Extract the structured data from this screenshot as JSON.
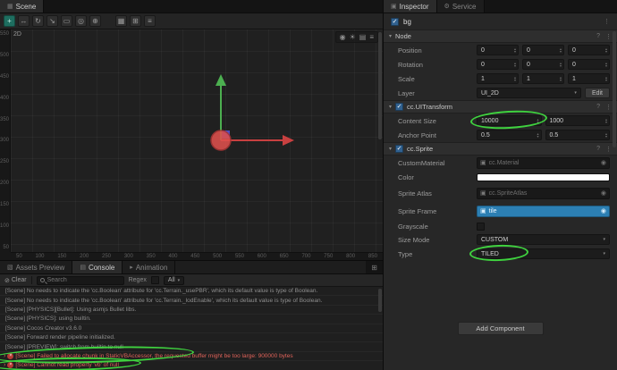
{
  "annotations": {
    "color": "#3fd23f"
  },
  "icons": {
    "menu": "⋮",
    "help": "?",
    "caret_down": "▾",
    "expand": "›",
    "checkbox_check": "✓",
    "asset_cube": "▣",
    "asset_pick": "◉",
    "stepper_up": "▴",
    "stepper_down": "▾",
    "select_caret": "▾",
    "error_badge": "×"
  },
  "scene": {
    "tab_label": "Scene",
    "tab_icon": "▦",
    "view_2d_label": "2D",
    "toolbar": {
      "left_icons": [
        "+",
        "↔",
        "↻",
        "↘",
        "▭",
        "◎",
        "⊕"
      ],
      "right_icons": [
        "▦",
        "⊞",
        "≡"
      ]
    },
    "view_icons": [
      "◉",
      "☀",
      "▤",
      "≡"
    ],
    "ruler_left": [
      "550",
      "500",
      "450",
      "400",
      "350",
      "300",
      "250",
      "200",
      "150",
      "100",
      "50"
    ],
    "ruler_bottom": [
      "50",
      "100",
      "150",
      "200",
      "250",
      "300",
      "350",
      "400",
      "450",
      "500",
      "550",
      "600",
      "650",
      "700",
      "750",
      "800",
      "850"
    ],
    "gizmo": {
      "x_color": "#c84040",
      "y_color": "#4caf50",
      "origin_color": "#df504d",
      "plane_color": "#5552d0"
    }
  },
  "console": {
    "tabs": {
      "assets": "Assets Preview",
      "console": "Console",
      "animation": "Animation"
    },
    "tab_icons": {
      "assets": "▧",
      "console": "▤",
      "animation": "▸",
      "panel_menu": "⊞"
    },
    "toolbar": {
      "clear_icon": "⊘",
      "clear_label": "Clear",
      "search_placeholder": "Search",
      "regex_label": "Regex",
      "filter_value": "All"
    },
    "logs": [
      {
        "type": "info",
        "caret": "",
        "badge": "",
        "text": "[Scene] No needs to indicate the 'cc.Boolean' attribute for 'cc.Terrain._usePBR', which its default value is type of Boolean."
      },
      {
        "type": "info",
        "caret": "",
        "badge": "",
        "text": "[Scene] No needs to indicate the 'cc.Boolean' attribute for 'cc.Terrain._lodEnable', which its default value is type of Boolean."
      },
      {
        "type": "info",
        "caret": "",
        "badge": "",
        "text": "[Scene] [PHYSICS][Bullet]: Using asmjs Bullet libs."
      },
      {
        "type": "info",
        "caret": "",
        "badge": "",
        "text": "[Scene] [PHYSICS]: using builtin."
      },
      {
        "type": "info",
        "caret": "",
        "badge": "",
        "text": "[Scene] Cocos Creator v3.6.0"
      },
      {
        "type": "info",
        "caret": "",
        "badge": "",
        "text": "[Scene] Forward render pipeline initialized."
      },
      {
        "type": "info",
        "caret": "",
        "badge": "",
        "text": "[Scene] [PREVIEW]: switch from builtin to null"
      },
      {
        "type": "error",
        "caret": "›",
        "badge": "×",
        "text": "[Scene] Failed to allocate chunk in StaticVBAccessor, the requested buffer might be too large: 900000 bytes"
      },
      {
        "type": "error",
        "caret": "›",
        "badge": "×",
        "text": "[Scene] Cannot read property 'vb' of null"
      }
    ]
  },
  "inspector": {
    "tabs": {
      "inspector": "Inspector",
      "service": "Service"
    },
    "tab_icons": {
      "inspector": "▣",
      "service": "⚙"
    },
    "node": {
      "name": "bg"
    },
    "node_section": {
      "title": "Node",
      "position": {
        "label": "Position",
        "x": "0",
        "y": "0",
        "z": "0"
      },
      "rotation": {
        "label": "Rotation",
        "x": "0",
        "y": "0",
        "z": "0"
      },
      "scale": {
        "label": "Scale",
        "x": "1",
        "y": "1",
        "z": "1"
      },
      "layer": {
        "label": "Layer",
        "value": "UI_2D",
        "edit": "Edit"
      }
    },
    "uitransform": {
      "title": "cc.UITransform",
      "content_size": {
        "label": "Content Size",
        "w": "10000",
        "h": "1000"
      },
      "anchor": {
        "label": "Anchor Point",
        "x": "0.5",
        "y": "0.5"
      }
    },
    "sprite": {
      "title": "cc.Sprite",
      "custom_material": {
        "label": "CustomMaterial",
        "placeholder": "cc.Material"
      },
      "color": {
        "label": "Color",
        "value": "#FFFFFF"
      },
      "atlas": {
        "label": "Sprite Atlas",
        "placeholder": "cc.SpriteAtlas"
      },
      "frame": {
        "label": "Sprite Frame",
        "value": "tile"
      },
      "grayscale": {
        "label": "Grayscale"
      },
      "size_mode": {
        "label": "Size Mode",
        "value": "CUSTOM"
      },
      "type": {
        "label": "Type",
        "value": "TILED"
      }
    },
    "add_component": "Add Component"
  }
}
